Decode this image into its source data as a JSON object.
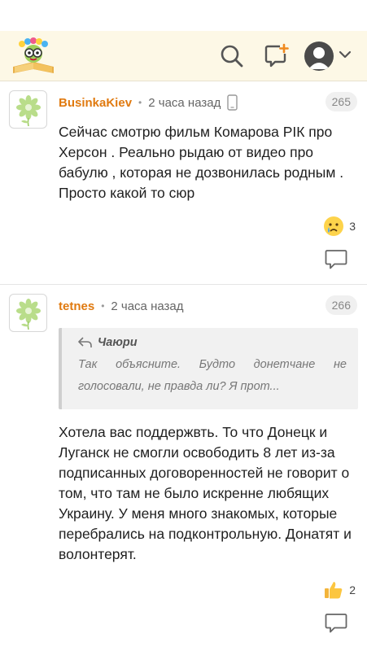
{
  "header": {
    "logo": "bookworm-logo",
    "icons": [
      "search-icon",
      "new-post-icon",
      "user-avatar",
      "chevron-down-icon"
    ]
  },
  "comments": [
    {
      "author": "BusinkaKiev",
      "time": "2 часа назад",
      "device": "phone-icon",
      "number": "265",
      "text": "Сейчас смотрю фильм Комарова РІК про Херсон . Реально рыдаю от видео про бабулю , которая не дозвонилась родным . Просто какой то сюр",
      "reaction": {
        "emoji": "crying-face-icon",
        "count": "3"
      }
    },
    {
      "author": "tetnes",
      "time": "2 часа назад",
      "number": "266",
      "quote": {
        "author": "Чаюри",
        "text": "Так объясните. Будто донетчане не голосовали, не правда ли? Я прот..."
      },
      "text": "Хотела вас поддержвть. То что Донецк и Луганск не смогли освободить 8 лет из-за подписанных договоренностей не говорит о том, что там не было искренне любящих Украину. У меня много знакомых, которые перебрались на подконтрольную. Донатят и волонтерят.",
      "reaction": {
        "emoji": "thumbs-up-icon",
        "count": "2"
      }
    }
  ]
}
